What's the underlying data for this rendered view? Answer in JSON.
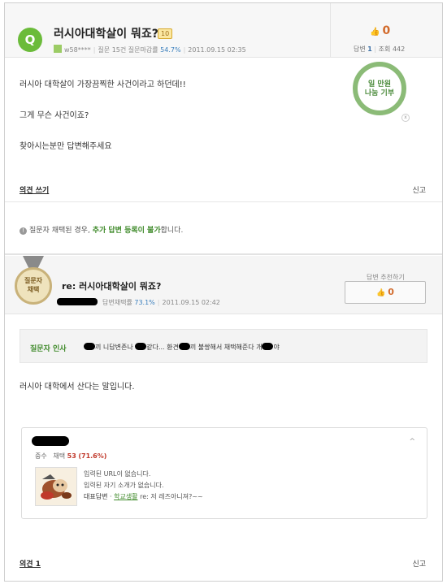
{
  "question": {
    "badge": "Q",
    "title": "러시아대학살이 뭐죠?",
    "level": "10",
    "user": "w58****",
    "question_label": "질문 15",
    "rate_label": "건 질문마감률",
    "rate": "54.7%",
    "date": "2011.09.15 02:35",
    "likes": "0",
    "answers_label": "답변",
    "answers": "1",
    "views_label": "조회",
    "views": "442",
    "body": [
      "러시아 대학살이 가장끔찍한 사건이라고 하던데!!",
      "그게 무슨 사건이죠?",
      "찾아시는분만 답변해주세요"
    ],
    "donate_line1": "일 만원",
    "donate_line2": "나눔 기부",
    "donate_close": "x",
    "opinion_label": "의견 쓰기",
    "report_label": "신고"
  },
  "notice": {
    "part1": "질문자 채택된 경우, ",
    "highlight": "추가 답변 등록이 불가",
    "part2": "합니다."
  },
  "answer": {
    "medal_line1": "질문자",
    "medal_line2": "채택",
    "title": "re: 러시아대학살이 뭐죠?",
    "rate_label": "답변채택률",
    "rate": "73.1%",
    "date": "2011.09.15 02:42",
    "recommend_label": "답변 추천하기",
    "likes": "0",
    "asker_label": "질문자 인사",
    "asker_parts": [
      "끼 니답변존나 ",
      "같다... 환견",
      "끼 불쌍해서 채택해준다 개",
      "야"
    ],
    "body": "러시아 대학에서 산다는 말입니다.",
    "opinion_label": "의견 1",
    "report_label": "신고"
  },
  "profile": {
    "rank": "중수",
    "adopt_label": "채택",
    "adopt_count": "53",
    "adopt_rate": "(71.6%)",
    "url": "입력된 URL이 없습니다.",
    "intro": "입력된 자기 소개가 없습니다.",
    "repr_label": "대표답변",
    "repr_category": "학교생활",
    "repr_title": "re: 저 레즈아니져?~~"
  }
}
